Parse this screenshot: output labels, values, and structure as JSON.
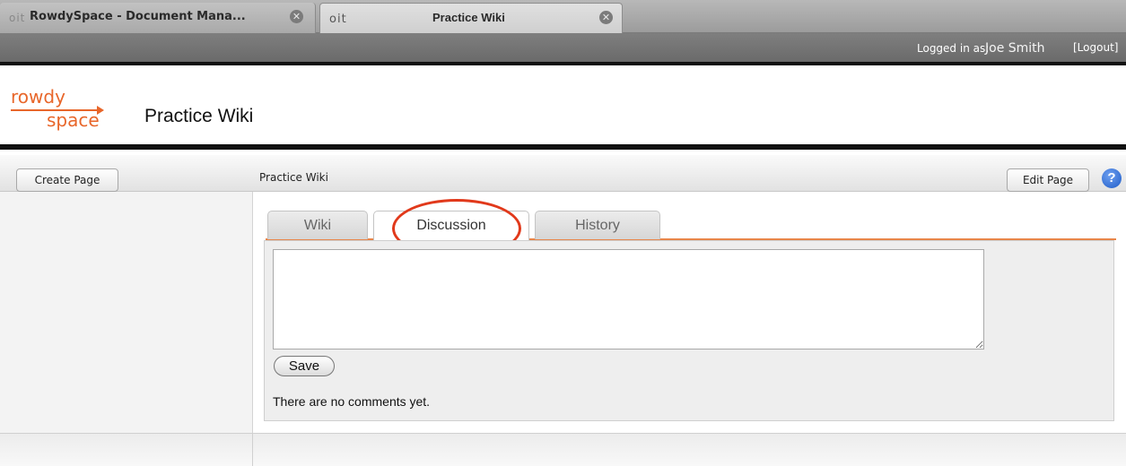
{
  "browser": {
    "tabs": [
      {
        "favicon": "oit",
        "title": "RowdySpace - Document Mana...",
        "active": false
      },
      {
        "favicon": "oit",
        "title": "Practice Wiki",
        "active": true
      }
    ],
    "close_glyph": "✕"
  },
  "login": {
    "label": "Logged in as:",
    "user": "Joe Smith",
    "logout": "[Logout]"
  },
  "header": {
    "logo_top": "rowdy",
    "logo_bottom": "space",
    "site_title": "Practice Wiki"
  },
  "toolbar": {
    "create_label": "Create Page",
    "breadcrumb": "Practice Wiki",
    "edit_label": "Edit Page",
    "help_glyph": "?"
  },
  "tabs": {
    "wiki": "Wiki",
    "discussion": "Discussion",
    "history": "History",
    "selected": "Discussion"
  },
  "discussion": {
    "comment_value": "",
    "save_label": "Save",
    "status": "There are no comments yet."
  },
  "colors": {
    "accent": "#e8662a",
    "highlight": "#e1391b",
    "help": "#1e5cc8"
  }
}
